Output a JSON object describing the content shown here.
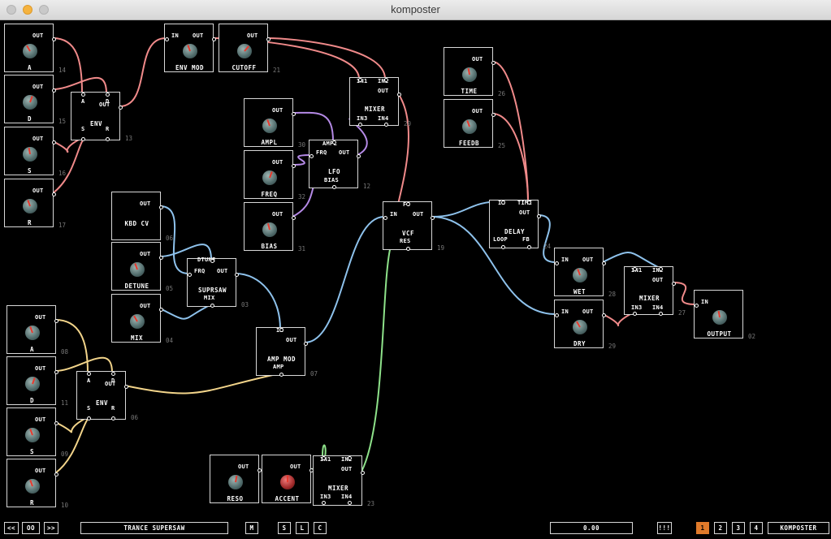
{
  "window": {
    "title": "komposter"
  },
  "colors": {
    "wire_red": "#f08a8a",
    "wire_blue": "#8ec2ec",
    "wire_purple": "#b58ae6",
    "wire_yellow": "#f2d48a",
    "wire_green": "#8ee28a",
    "accent_orange": "#e07a2a"
  },
  "modules": [
    {
      "key": "a1",
      "name": "A",
      "id": "14",
      "knob": true,
      "ports": [
        "OUT"
      ]
    },
    {
      "key": "d1",
      "name": "D",
      "id": "15",
      "knob": true,
      "ports": [
        "OUT"
      ]
    },
    {
      "key": "s1",
      "name": "S",
      "id": "16",
      "knob": true,
      "ports": [
        "OUT"
      ]
    },
    {
      "key": "r1",
      "name": "R",
      "id": "17",
      "knob": true,
      "ports": [
        "OUT"
      ]
    },
    {
      "key": "env1",
      "name": "ENV",
      "id": "13",
      "knob": false,
      "ports": [
        "A",
        "D",
        "OUT",
        "S",
        "R"
      ]
    },
    {
      "key": "envmod",
      "name": "ENV MOD",
      "id": "",
      "knob": true,
      "ports": [
        "IN",
        "OUT"
      ]
    },
    {
      "key": "cutoff",
      "name": "CUTOFF",
      "id": "21",
      "knob": true,
      "ports": [
        "OUT"
      ]
    },
    {
      "key": "mixer1",
      "name": "MIXER",
      "id": "20",
      "knob": false,
      "ports": [
        "IN1",
        "IN2",
        "OUT",
        "IN3",
        "IN4"
      ]
    },
    {
      "key": "ampl",
      "name": "AMPL",
      "id": "30",
      "knob": true,
      "ports": [
        "OUT"
      ]
    },
    {
      "key": "freq",
      "name": "FREQ",
      "id": "32",
      "knob": true,
      "ports": [
        "OUT"
      ]
    },
    {
      "key": "bias",
      "name": "BIAS",
      "id": "31",
      "knob": true,
      "ports": [
        "OUT"
      ]
    },
    {
      "key": "lfo",
      "name": "LFO",
      "id": "12",
      "knob": false,
      "ports": [
        "AMPL",
        "FRQ",
        "OUT",
        "BIAS"
      ]
    },
    {
      "key": "time",
      "name": "TIME",
      "id": "26",
      "knob": true,
      "ports": [
        "OUT"
      ]
    },
    {
      "key": "feedb",
      "name": "FEEDB",
      "id": "25",
      "knob": true,
      "ports": [
        "OUT"
      ]
    },
    {
      "key": "kbdcv",
      "name": "KBD CV",
      "id": "06",
      "knob": false,
      "ports": [
        "OUT"
      ]
    },
    {
      "key": "detune",
      "name": "DETUNE",
      "id": "05",
      "knob": true,
      "ports": [
        "OUT"
      ]
    },
    {
      "key": "mix",
      "name": "MIX",
      "id": "04",
      "knob": true,
      "ports": [
        "OUT"
      ]
    },
    {
      "key": "supsaw",
      "name": "SUPRSAW",
      "id": "03",
      "knob": false,
      "ports": [
        "DTUNE",
        "FRQ",
        "OUT",
        "MIX"
      ]
    },
    {
      "key": "vcf",
      "name": "VCF",
      "id": "19",
      "knob": false,
      "ports": [
        "FC",
        "IN",
        "OUT",
        "RES"
      ]
    },
    {
      "key": "delay",
      "name": "DELAY",
      "id": "24",
      "knob": false,
      "ports": [
        "IN",
        "TIME",
        "OUT",
        "LOOP",
        "FB"
      ]
    },
    {
      "key": "wet",
      "name": "WET",
      "id": "28",
      "knob": true,
      "ports": [
        "IN",
        "OUT"
      ]
    },
    {
      "key": "dry",
      "name": "DRY",
      "id": "29",
      "knob": true,
      "ports": [
        "IN",
        "OUT"
      ]
    },
    {
      "key": "mixer2",
      "name": "MIXER",
      "id": "27",
      "knob": false,
      "ports": [
        "IN1",
        "IN2",
        "OUT",
        "IN3",
        "IN4"
      ]
    },
    {
      "key": "output",
      "name": "OUTPUT",
      "id": "02",
      "knob": true,
      "ports": [
        "IN"
      ]
    },
    {
      "key": "a2",
      "name": "A",
      "id": "08",
      "knob": true,
      "ports": [
        "OUT"
      ]
    },
    {
      "key": "d2",
      "name": "D",
      "id": "11",
      "knob": true,
      "ports": [
        "OUT"
      ]
    },
    {
      "key": "s2",
      "name": "S",
      "id": "09",
      "knob": true,
      "ports": [
        "OUT"
      ]
    },
    {
      "key": "r2",
      "name": "R",
      "id": "10",
      "knob": true,
      "ports": [
        "OUT"
      ]
    },
    {
      "key": "env2",
      "name": "ENV",
      "id": "06",
      "knob": false,
      "ports": [
        "A",
        "D",
        "OUT",
        "S",
        "R"
      ]
    },
    {
      "key": "ampmod",
      "name": "AMP MOD",
      "id": "07",
      "knob": false,
      "ports": [
        "IN",
        "OUT",
        "AMP"
      ]
    },
    {
      "key": "reso",
      "name": "RESO",
      "id": "",
      "knob": true,
      "ports": [
        "OUT"
      ]
    },
    {
      "key": "accent",
      "name": "ACCENT",
      "id": "22",
      "knob": true,
      "ports": [
        "OUT"
      ]
    },
    {
      "key": "mixer3",
      "name": "MIXER",
      "id": "23",
      "knob": false,
      "ports": [
        "IN1",
        "IN2",
        "OUT",
        "IN3",
        "IN4"
      ]
    }
  ],
  "bottom": {
    "prev_label": "<<",
    "play_label": "OO",
    "next_label": ">>",
    "song_name": "TRANCE SUPERSAW",
    "m_label": "M",
    "s_label": "S",
    "l_label": "L",
    "c_label": "C",
    "time_display": "0.00",
    "menu_label": "!!!",
    "page1": "1",
    "page2": "2",
    "page3": "3",
    "page4": "4",
    "app_label": "KOMPOSTER"
  }
}
